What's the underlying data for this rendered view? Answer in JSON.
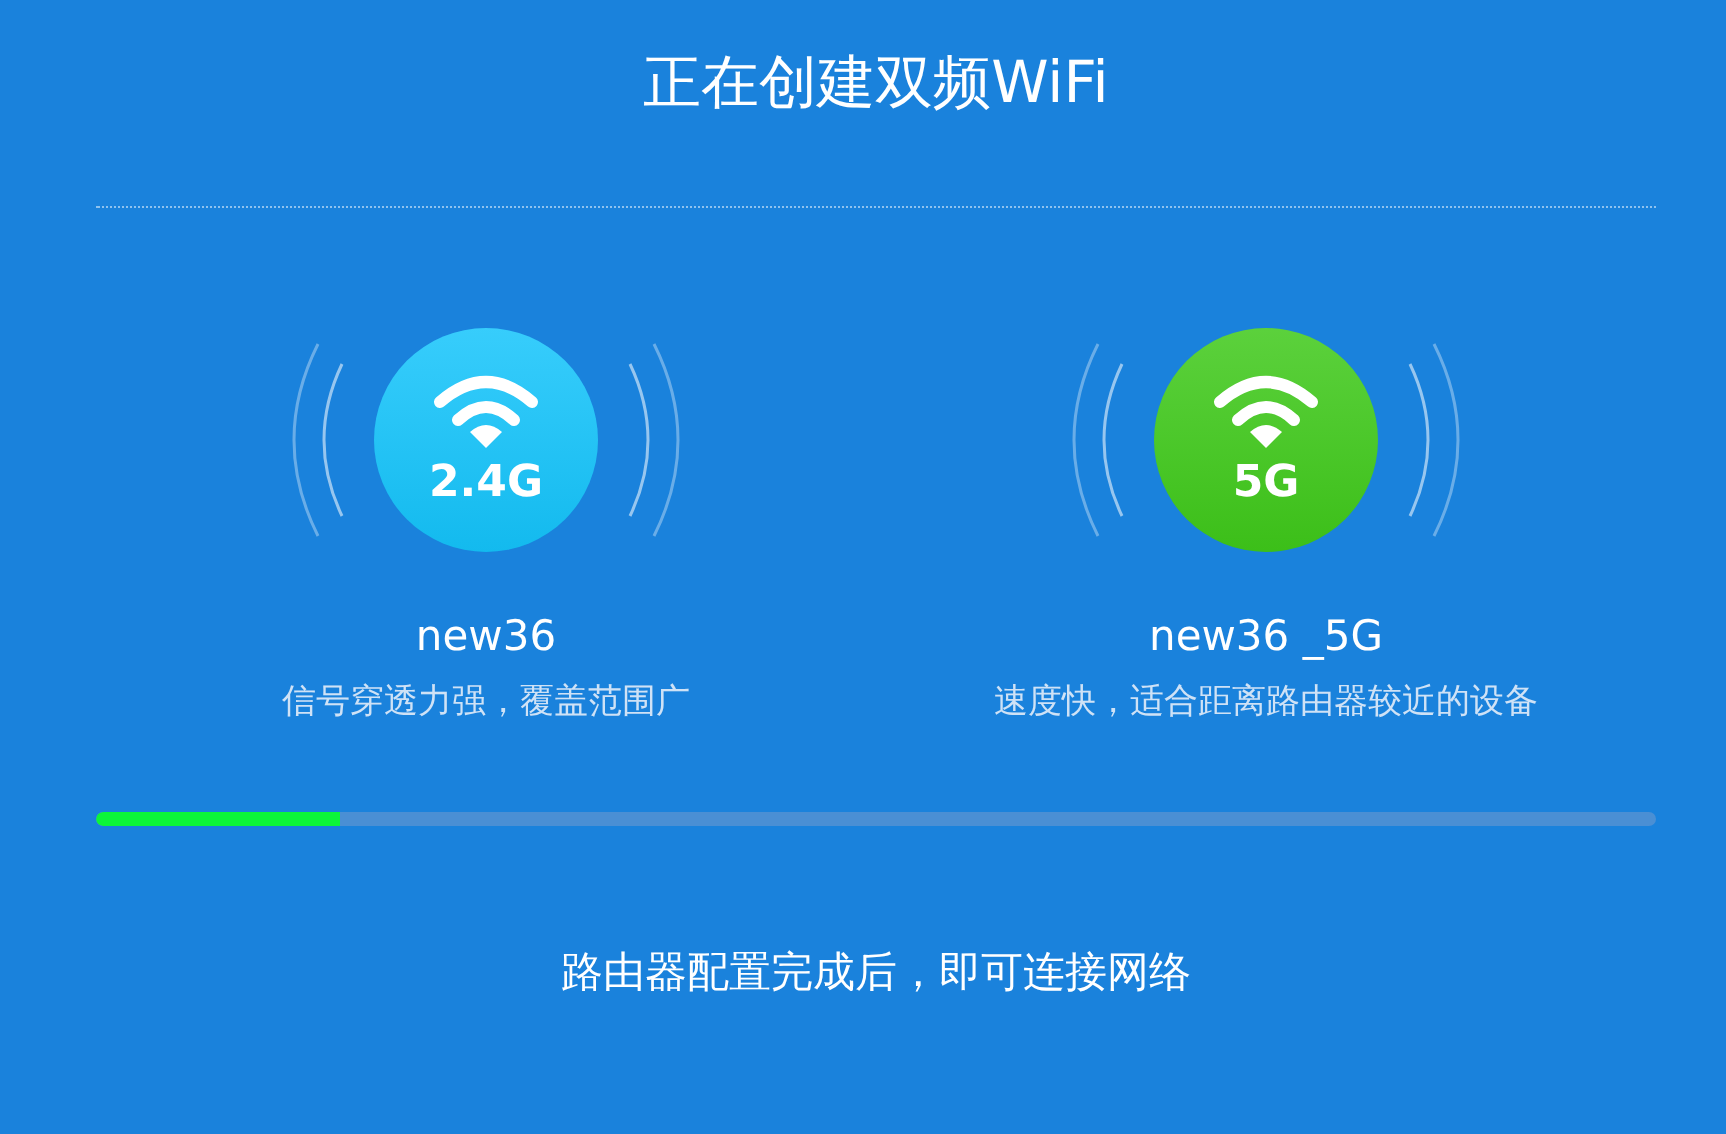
{
  "title": "正在创建双频WiFi",
  "bands": [
    {
      "badge": "2.4G",
      "color": "#14c4fb",
      "name": "new36",
      "description": "信号穿透力强，覆盖范围广"
    },
    {
      "badge": "5G",
      "color": "#3fc91a",
      "name": "new36 _5G",
      "description": "速度快，适合距离路由器较近的设备"
    }
  ],
  "progress": {
    "level": 0.156
  },
  "footer": "路由器配置完成后，即可连接网络"
}
